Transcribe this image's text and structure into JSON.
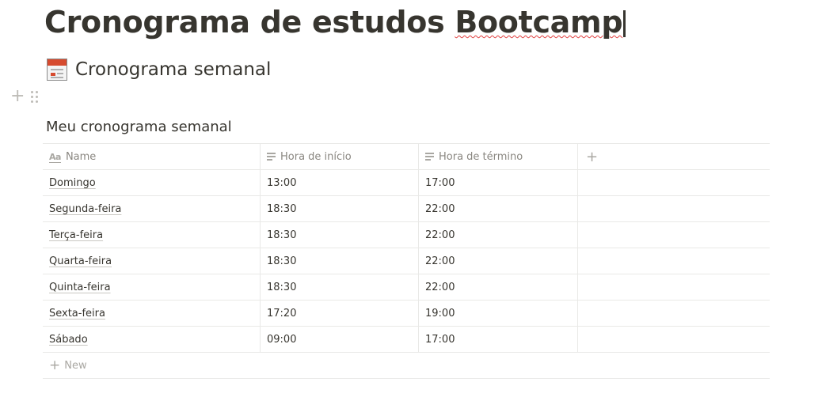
{
  "page": {
    "title_part1": "Cronograma de estudos ",
    "title_part2": "Bootcamp"
  },
  "section": {
    "icon": "calendar-icon",
    "heading": "Cronograma semanal"
  },
  "database": {
    "title": "Meu cronograma semanal",
    "columns": [
      {
        "label": "Name",
        "icon": "title-property-icon"
      },
      {
        "label": "Hora de início",
        "icon": "text-property-icon"
      },
      {
        "label": "Hora de término",
        "icon": "text-property-icon"
      }
    ],
    "add_column_icon": "plus-icon",
    "rows": [
      {
        "name": "Domingo",
        "start": "13:00",
        "end": "17:00"
      },
      {
        "name": "Segunda-feira",
        "start": "18:30",
        "end": "22:00"
      },
      {
        "name": "Terça-feira",
        "start": "18:30",
        "end": "22:00"
      },
      {
        "name": "Quarta-feira",
        "start": "18:30",
        "end": "22:00"
      },
      {
        "name": "Quinta-feira",
        "start": "18:30",
        "end": "22:00"
      },
      {
        "name": "Sexta-feira",
        "start": "17:20",
        "end": "19:00"
      },
      {
        "name": "Sábado",
        "start": "09:00",
        "end": "17:00"
      }
    ],
    "new_label": "New"
  },
  "colors": {
    "text": "#37352f",
    "muted": "#a9a7a2",
    "border": "#e9e9e7",
    "spellcheck": "#e03e3e"
  }
}
